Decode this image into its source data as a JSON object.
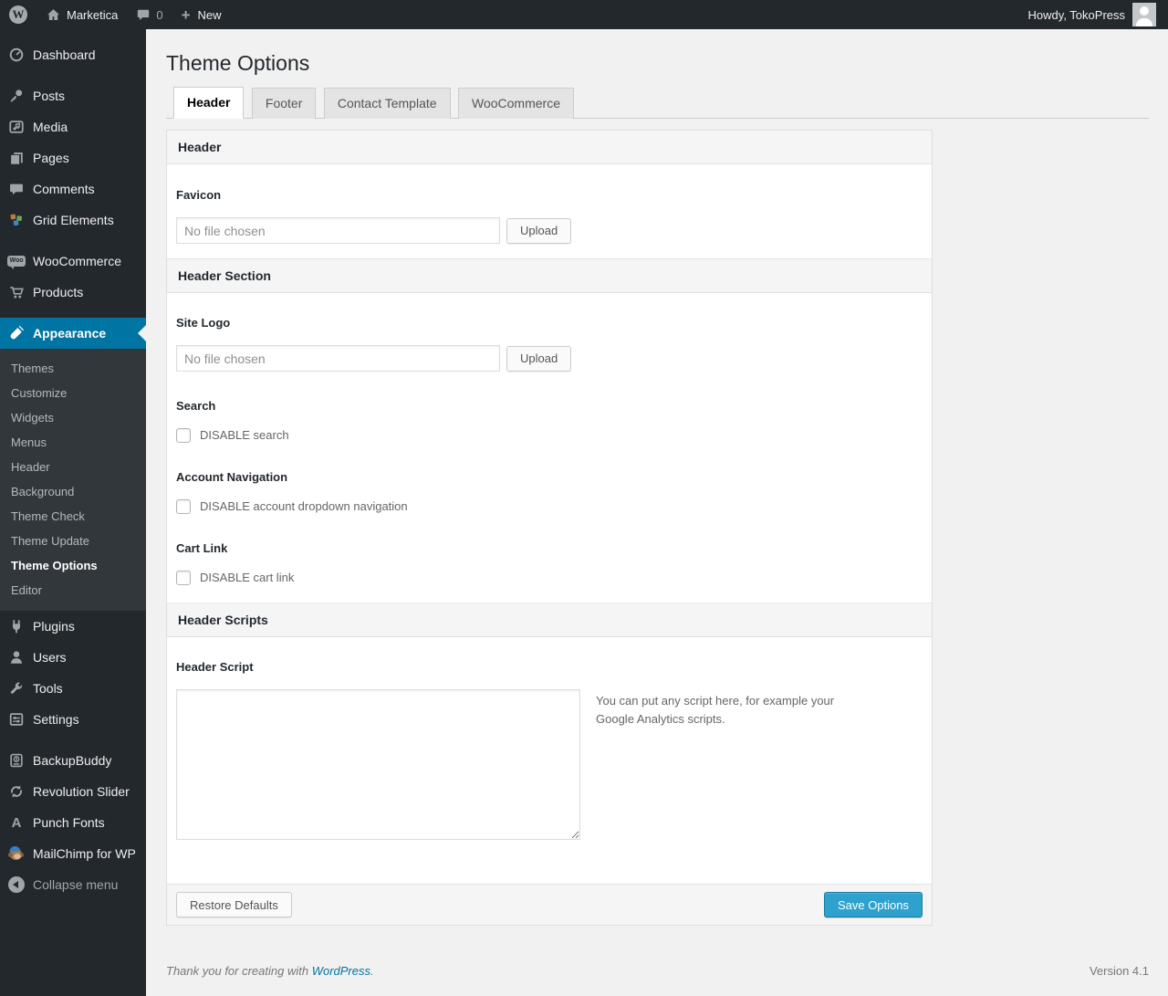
{
  "admin_bar": {
    "site_name": "Marketica",
    "comment_count": "0",
    "new_label": "New",
    "howdy_text": "Howdy, TokoPress"
  },
  "icons": {
    "wp_logo_letter": "W",
    "plus": "+",
    "woo_badge": "Woo",
    "punch_fonts_letter": "A"
  },
  "sidebar": {
    "items": [
      {
        "label": "Dashboard",
        "icon": "dashboard-icon"
      },
      {
        "label": "Posts",
        "icon": "pin-icon"
      },
      {
        "label": "Media",
        "icon": "media-icon"
      },
      {
        "label": "Pages",
        "icon": "pages-icon"
      },
      {
        "label": "Comments",
        "icon": "comment-icon"
      },
      {
        "label": "Grid Elements",
        "icon": "grid-elements-icon"
      },
      {
        "label": "WooCommerce",
        "icon": "woocommerce-badge-icon"
      },
      {
        "label": "Products",
        "icon": "cart-icon"
      },
      {
        "label": "Appearance",
        "icon": "paintbrush-icon"
      },
      {
        "label": "Plugins",
        "icon": "plug-icon"
      },
      {
        "label": "Users",
        "icon": "user-icon"
      },
      {
        "label": "Tools",
        "icon": "wrench-icon"
      },
      {
        "label": "Settings",
        "icon": "sliders-icon"
      },
      {
        "label": "BackupBuddy",
        "icon": "backup-icon"
      },
      {
        "label": "Revolution Slider",
        "icon": "refresh-icon"
      },
      {
        "label": "Punch Fonts",
        "icon": "letter-a-icon"
      },
      {
        "label": "MailChimp for WP",
        "icon": "mailchimp-monkey-icon"
      }
    ],
    "appearance_submenu": [
      "Themes",
      "Customize",
      "Widgets",
      "Menus",
      "Header",
      "Background",
      "Theme Check",
      "Theme Update",
      "Theme Options",
      "Editor"
    ],
    "active_submenu_item": "Theme Options",
    "collapse_label": "Collapse menu"
  },
  "page": {
    "title": "Theme Options",
    "tabs": [
      {
        "label": "Header",
        "active": true
      },
      {
        "label": "Footer",
        "active": false
      },
      {
        "label": "Contact Template",
        "active": false
      },
      {
        "label": "WooCommerce",
        "active": false
      }
    ]
  },
  "form": {
    "section_header": "Header",
    "favicon_label": "Favicon",
    "file_placeholder": "No file chosen",
    "upload_label": "Upload",
    "section_header_section": "Header Section",
    "site_logo_label": "Site Logo",
    "search_label": "Search",
    "search_checkbox_label": "DISABLE search",
    "account_nav_label": "Account Navigation",
    "account_checkbox_label": "DISABLE account dropdown navigation",
    "cart_link_label": "Cart Link",
    "cart_checkbox_label": "DISABLE cart link",
    "section_header_scripts": "Header Scripts",
    "header_script_label": "Header Script",
    "script_value": "",
    "script_note": "You can put any script here, for example your Google Analytics scripts.",
    "restore_button": "Restore Defaults",
    "save_button": "Save Options"
  },
  "footer": {
    "thanks_prefix": "Thank you for creating with ",
    "wordpress_link": "WordPress",
    "thanks_suffix": ".",
    "version": "Version 4.1"
  },
  "colors": {
    "accent_blue": "#0074a2",
    "primary_button": "#2ea2cc",
    "admin_bar_bg": "#23282d",
    "submenu_bg": "#32373c",
    "page_bg": "#f1f1f1"
  }
}
